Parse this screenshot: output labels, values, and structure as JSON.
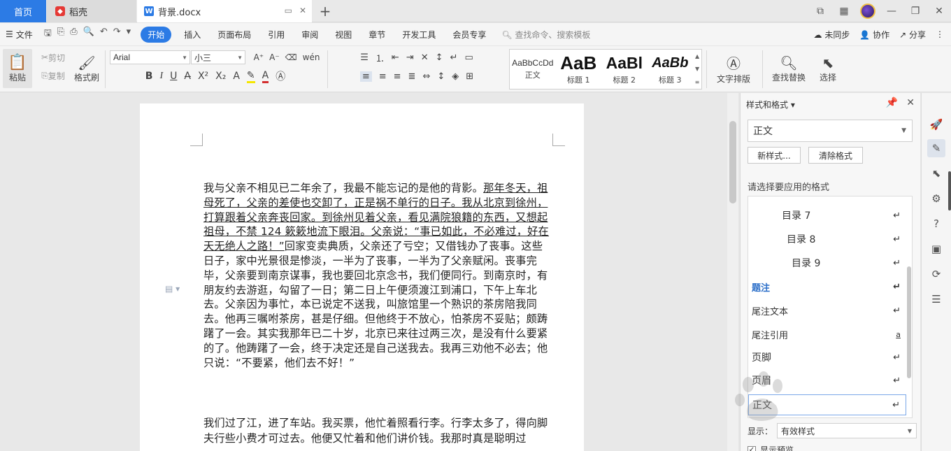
{
  "tabs": {
    "home": "首页",
    "daoke": "稻壳",
    "doc": "背景.docx",
    "add": "+"
  },
  "menu": {
    "file": "文件",
    "items": [
      "开始",
      "插入",
      "页面布局",
      "引用",
      "审阅",
      "视图",
      "章节",
      "开发工具",
      "会员专享"
    ],
    "search": "查找命令、搜索模板",
    "sync": "未同步",
    "collab": "协作",
    "share": "分享"
  },
  "ribbon": {
    "paste": "粘贴",
    "cut": "剪切",
    "copy": "复制",
    "format_painter": "格式刷",
    "font_name": "Arial",
    "font_size": "小三",
    "styles": [
      {
        "preview": "AaBbCcDd",
        "label": "正文"
      },
      {
        "preview": "AaB",
        "label": "标题 1"
      },
      {
        "preview": "AaBl",
        "label": "标题 2"
      },
      {
        "preview": "AaBb",
        "label": "标题 3"
      }
    ],
    "text_layout": "文字排版",
    "find_replace": "查找替换",
    "select": "选择"
  },
  "document": {
    "para1_underlined": "那年冬天，祖母死了，父亲的差使也交卸了，正是祸不单行的日子。我从北京到徐州，打算跟着父亲奔丧回家。到徐州见着父亲，看见满院狼籍的东西，又想起祖母，不禁 124 簌簌地流下眼泪。父亲说：“事已如此，不必难过，好在天无绝人之路！”",
    "para1_start": "我与父亲不相见已二年余了，我最不能忘记的是他的背影。",
    "para1_rest": "回家变卖典质，父亲还了亏空；又借钱办了丧事。这些日子，家中光景很是惨淡，一半为了丧事，一半为了父亲赋闲。丧事完毕，父亲要到南京谋事，我也要回北京念书，我们便同行。到南京时，有朋友约去游逛，勾留了一日；第二日上午便须渡江到浦口，下午上车北去。父亲因为事忙，本已说定不送我，叫旅馆里一个熟识的茶房陪我同去。他再三嘱咐茶房，甚是仔细。但他终于不放心，怕茶房不妥贴；颇踌躇了一会。其实我那年已二十岁，北京已来往过两三次，是没有什么要紧的了。他踌躇了一会，终于决定还是自己送我去。我再三劝他不必去；他只说：“不要紧，他们去不好！”",
    "para2": "我们过了江，进了车站。我买票，他忙着照看行李。行李太多了，得向脚夫行些小费才可过去。他便又忙着和他们讲价钱。我那时真是聪明过"
  },
  "panel": {
    "title": "样式和格式",
    "current_style": "正文",
    "new_style": "新样式...",
    "clear_format": "清除格式",
    "hint": "请选择要应用的格式",
    "styles": [
      {
        "name": "目录 7",
        "mark": "↵"
      },
      {
        "name": "目录 8",
        "mark": "↵"
      },
      {
        "name": "目录 9",
        "mark": "↵"
      },
      {
        "name": "题注",
        "mark": "↵"
      },
      {
        "name": "尾注文本",
        "mark": "↵"
      },
      {
        "name": "尾注引用",
        "mark": "a"
      },
      {
        "name": "页脚",
        "mark": "↵"
      },
      {
        "name": "页眉",
        "mark": "↵"
      },
      {
        "name": "正文",
        "mark": "↵"
      }
    ],
    "show_label": "显示：",
    "show_value": "有效样式",
    "preview_label": "显示预览"
  },
  "colors": {
    "accent": "#2c7be5",
    "caption_style": "#2c6fc9"
  }
}
